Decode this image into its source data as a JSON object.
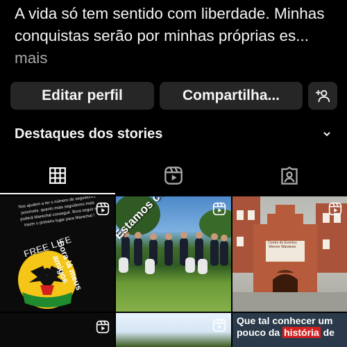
{
  "bio": {
    "text": "A vida só tem sentido com liberdade. Minhas conquistas serão por minhas próprias es...",
    "more": " mais"
  },
  "buttons": {
    "edit_profile": "Editar perfil",
    "share_profile": "Compartilha...",
    "discover_people_icon": "add-person-icon"
  },
  "highlights": {
    "title": "Destaques dos stories",
    "chevron_icon": "chevron-down-icon"
  },
  "tabs": [
    {
      "icon": "grid-icon",
      "active": true
    },
    {
      "icon": "reels-icon",
      "active": false
    },
    {
      "icon": "tagged-icon",
      "active": false
    }
  ],
  "posts": {
    "post1": {
      "small_text": "Nos ajudem a ter o número de seguidores possíveis. quanto mais seguidores mais poderá Marechal conseguir. Bora seguir e trazer o primeiro lugar para Marechal !",
      "logo_text": "FREE LIFE",
      "side_text": "Bora lá meus amigos"
    },
    "post2": {
      "stamp": "Estamos como:"
    },
    "post3": {
      "plaque": "Centro de Eventos Werner Wanderer"
    },
    "post6": {
      "caption_a": "Que tal conhecer um pouco da ",
      "caption_hl": "história",
      "caption_b": " de"
    }
  }
}
